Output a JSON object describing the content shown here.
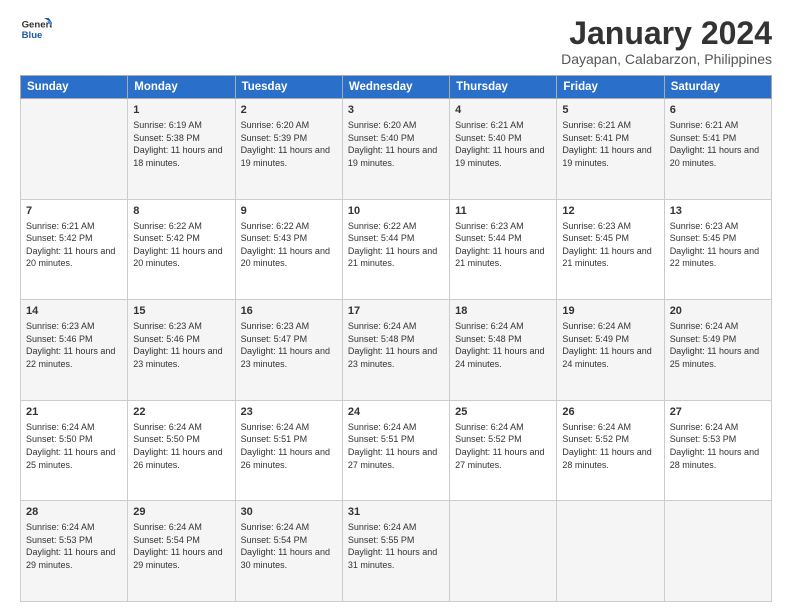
{
  "logo": {
    "line1": "General",
    "line2": "Blue"
  },
  "title": "January 2024",
  "subtitle": "Dayapan, Calabarzon, Philippines",
  "headers": [
    "Sunday",
    "Monday",
    "Tuesday",
    "Wednesday",
    "Thursday",
    "Friday",
    "Saturday"
  ],
  "weeks": [
    [
      {
        "day": "",
        "sunrise": "",
        "sunset": "",
        "daylight": ""
      },
      {
        "day": "1",
        "sunrise": "Sunrise: 6:19 AM",
        "sunset": "Sunset: 5:38 PM",
        "daylight": "Daylight: 11 hours and 18 minutes."
      },
      {
        "day": "2",
        "sunrise": "Sunrise: 6:20 AM",
        "sunset": "Sunset: 5:39 PM",
        "daylight": "Daylight: 11 hours and 19 minutes."
      },
      {
        "day": "3",
        "sunrise": "Sunrise: 6:20 AM",
        "sunset": "Sunset: 5:40 PM",
        "daylight": "Daylight: 11 hours and 19 minutes."
      },
      {
        "day": "4",
        "sunrise": "Sunrise: 6:21 AM",
        "sunset": "Sunset: 5:40 PM",
        "daylight": "Daylight: 11 hours and 19 minutes."
      },
      {
        "day": "5",
        "sunrise": "Sunrise: 6:21 AM",
        "sunset": "Sunset: 5:41 PM",
        "daylight": "Daylight: 11 hours and 19 minutes."
      },
      {
        "day": "6",
        "sunrise": "Sunrise: 6:21 AM",
        "sunset": "Sunset: 5:41 PM",
        "daylight": "Daylight: 11 hours and 20 minutes."
      }
    ],
    [
      {
        "day": "7",
        "sunrise": "Sunrise: 6:21 AM",
        "sunset": "Sunset: 5:42 PM",
        "daylight": "Daylight: 11 hours and 20 minutes."
      },
      {
        "day": "8",
        "sunrise": "Sunrise: 6:22 AM",
        "sunset": "Sunset: 5:42 PM",
        "daylight": "Daylight: 11 hours and 20 minutes."
      },
      {
        "day": "9",
        "sunrise": "Sunrise: 6:22 AM",
        "sunset": "Sunset: 5:43 PM",
        "daylight": "Daylight: 11 hours and 20 minutes."
      },
      {
        "day": "10",
        "sunrise": "Sunrise: 6:22 AM",
        "sunset": "Sunset: 5:44 PM",
        "daylight": "Daylight: 11 hours and 21 minutes."
      },
      {
        "day": "11",
        "sunrise": "Sunrise: 6:23 AM",
        "sunset": "Sunset: 5:44 PM",
        "daylight": "Daylight: 11 hours and 21 minutes."
      },
      {
        "day": "12",
        "sunrise": "Sunrise: 6:23 AM",
        "sunset": "Sunset: 5:45 PM",
        "daylight": "Daylight: 11 hours and 21 minutes."
      },
      {
        "day": "13",
        "sunrise": "Sunrise: 6:23 AM",
        "sunset": "Sunset: 5:45 PM",
        "daylight": "Daylight: 11 hours and 22 minutes."
      }
    ],
    [
      {
        "day": "14",
        "sunrise": "Sunrise: 6:23 AM",
        "sunset": "Sunset: 5:46 PM",
        "daylight": "Daylight: 11 hours and 22 minutes."
      },
      {
        "day": "15",
        "sunrise": "Sunrise: 6:23 AM",
        "sunset": "Sunset: 5:46 PM",
        "daylight": "Daylight: 11 hours and 23 minutes."
      },
      {
        "day": "16",
        "sunrise": "Sunrise: 6:23 AM",
        "sunset": "Sunset: 5:47 PM",
        "daylight": "Daylight: 11 hours and 23 minutes."
      },
      {
        "day": "17",
        "sunrise": "Sunrise: 6:24 AM",
        "sunset": "Sunset: 5:48 PM",
        "daylight": "Daylight: 11 hours and 23 minutes."
      },
      {
        "day": "18",
        "sunrise": "Sunrise: 6:24 AM",
        "sunset": "Sunset: 5:48 PM",
        "daylight": "Daylight: 11 hours and 24 minutes."
      },
      {
        "day": "19",
        "sunrise": "Sunrise: 6:24 AM",
        "sunset": "Sunset: 5:49 PM",
        "daylight": "Daylight: 11 hours and 24 minutes."
      },
      {
        "day": "20",
        "sunrise": "Sunrise: 6:24 AM",
        "sunset": "Sunset: 5:49 PM",
        "daylight": "Daylight: 11 hours and 25 minutes."
      }
    ],
    [
      {
        "day": "21",
        "sunrise": "Sunrise: 6:24 AM",
        "sunset": "Sunset: 5:50 PM",
        "daylight": "Daylight: 11 hours and 25 minutes."
      },
      {
        "day": "22",
        "sunrise": "Sunrise: 6:24 AM",
        "sunset": "Sunset: 5:50 PM",
        "daylight": "Daylight: 11 hours and 26 minutes."
      },
      {
        "day": "23",
        "sunrise": "Sunrise: 6:24 AM",
        "sunset": "Sunset: 5:51 PM",
        "daylight": "Daylight: 11 hours and 26 minutes."
      },
      {
        "day": "24",
        "sunrise": "Sunrise: 6:24 AM",
        "sunset": "Sunset: 5:51 PM",
        "daylight": "Daylight: 11 hours and 27 minutes."
      },
      {
        "day": "25",
        "sunrise": "Sunrise: 6:24 AM",
        "sunset": "Sunset: 5:52 PM",
        "daylight": "Daylight: 11 hours and 27 minutes."
      },
      {
        "day": "26",
        "sunrise": "Sunrise: 6:24 AM",
        "sunset": "Sunset: 5:52 PM",
        "daylight": "Daylight: 11 hours and 28 minutes."
      },
      {
        "day": "27",
        "sunrise": "Sunrise: 6:24 AM",
        "sunset": "Sunset: 5:53 PM",
        "daylight": "Daylight: 11 hours and 28 minutes."
      }
    ],
    [
      {
        "day": "28",
        "sunrise": "Sunrise: 6:24 AM",
        "sunset": "Sunset: 5:53 PM",
        "daylight": "Daylight: 11 hours and 29 minutes."
      },
      {
        "day": "29",
        "sunrise": "Sunrise: 6:24 AM",
        "sunset": "Sunset: 5:54 PM",
        "daylight": "Daylight: 11 hours and 29 minutes."
      },
      {
        "day": "30",
        "sunrise": "Sunrise: 6:24 AM",
        "sunset": "Sunset: 5:54 PM",
        "daylight": "Daylight: 11 hours and 30 minutes."
      },
      {
        "day": "31",
        "sunrise": "Sunrise: 6:24 AM",
        "sunset": "Sunset: 5:55 PM",
        "daylight": "Daylight: 11 hours and 31 minutes."
      },
      {
        "day": "",
        "sunrise": "",
        "sunset": "",
        "daylight": ""
      },
      {
        "day": "",
        "sunrise": "",
        "sunset": "",
        "daylight": ""
      },
      {
        "day": "",
        "sunrise": "",
        "sunset": "",
        "daylight": ""
      }
    ]
  ]
}
